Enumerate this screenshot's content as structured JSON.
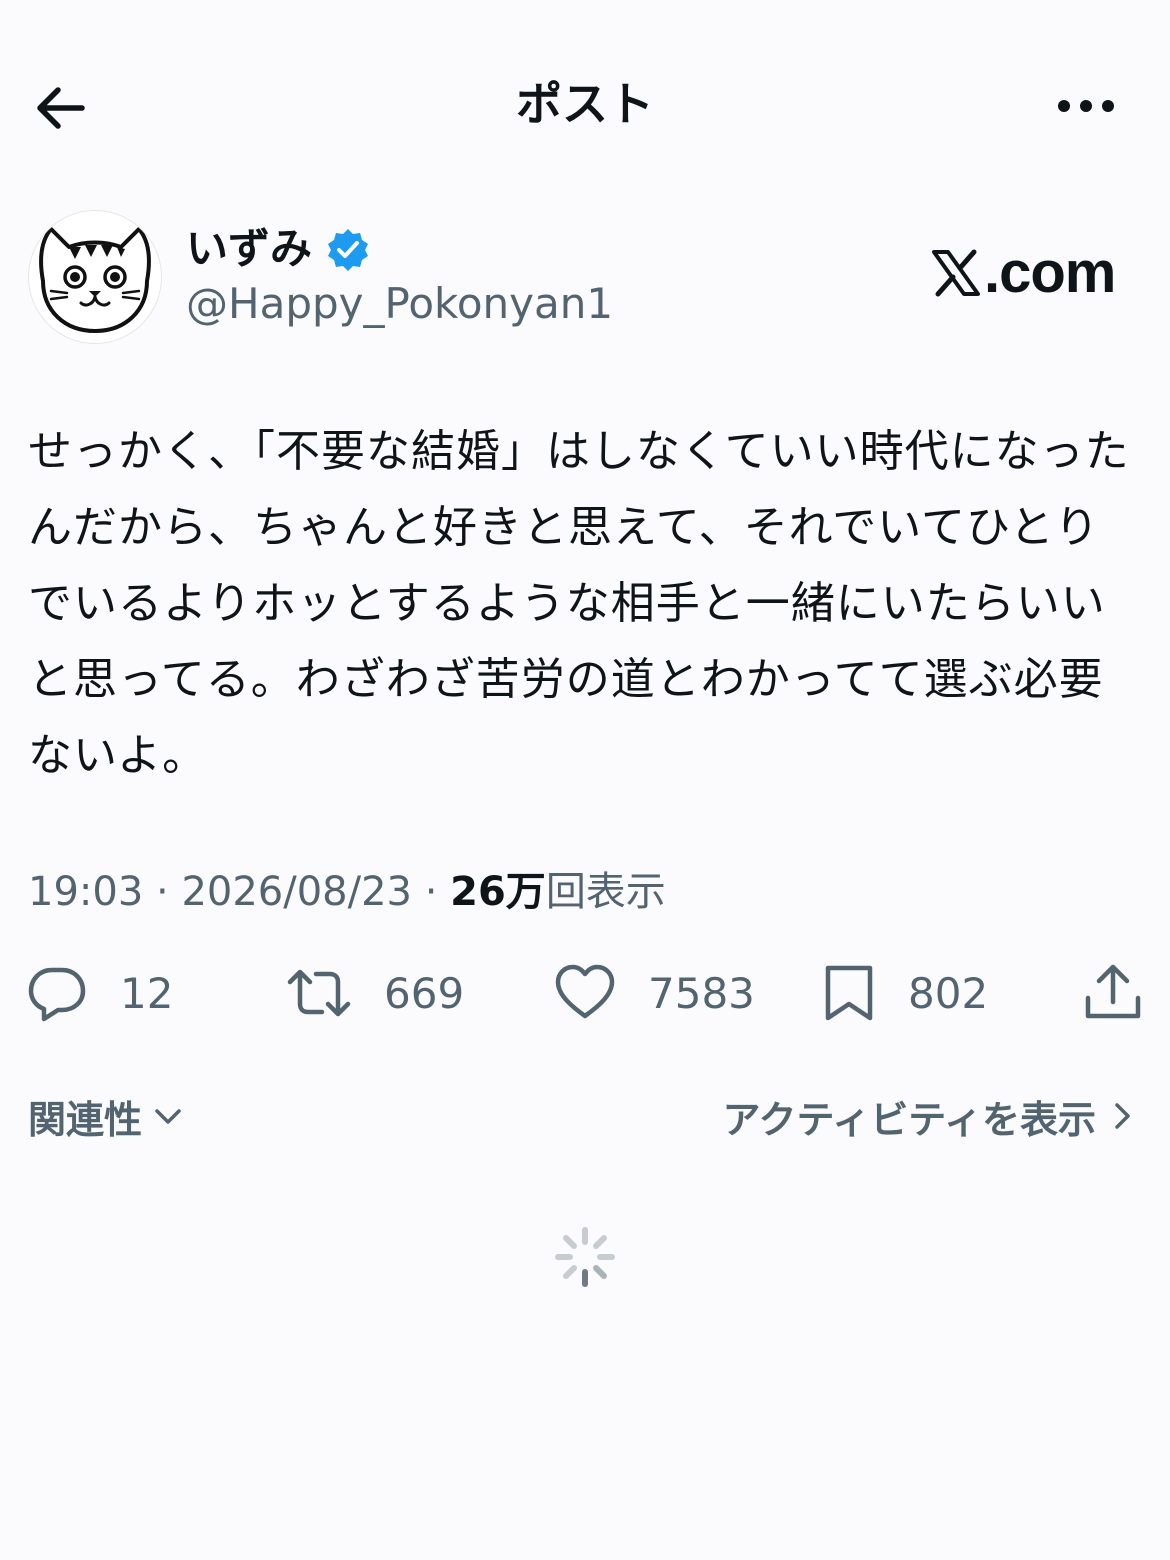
{
  "header": {
    "title": "ポスト",
    "back_icon": "arrow-left-icon",
    "more_icon": "more-horizontal-icon"
  },
  "author": {
    "display_name": "いずみ",
    "handle": "@Happy_Pokonyan1",
    "verified": true,
    "verified_color": "#1d9bf0"
  },
  "watermark": {
    "text": ".com"
  },
  "post": {
    "text": "せっかく、「不要な結婚」はしなくていい時代になったんだから、ちゃんと好きと思えて、それでいてひとりでいるよりホッとするような相手と一緒にいたらいいと思ってる。わざわざ苦労の道とわかってて選ぶ必要ないよ。",
    "time": "19:03",
    "date": "2026/08/23",
    "views_count": "26万",
    "views_label": "回表示"
  },
  "actions": {
    "reply_count": "12",
    "repost_count": "669",
    "like_count": "7583",
    "bookmark_count": "802"
  },
  "replies": {
    "sort_label": "関連性",
    "activity_label": "アクティビティを表示"
  },
  "colors": {
    "text": "#0f1419",
    "secondary": "#536471",
    "background": "#fbfbfd"
  }
}
